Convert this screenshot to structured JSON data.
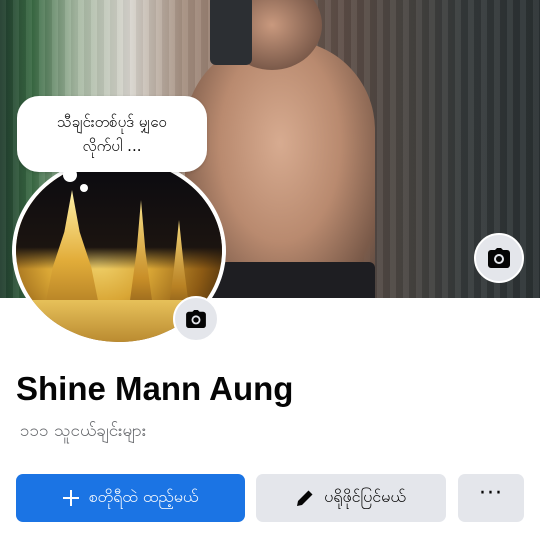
{
  "profile": {
    "name": "Shine Mann Aung",
    "friends": "၁၁၁ သူငယ်ချင်းများ"
  },
  "note_bubble": {
    "line1": "သီချင်းတစ်ပုဒ် မျှဝေ",
    "line2": "လိုက်ပါ ..."
  },
  "actions": {
    "add_story_label": "စတိုရီထဲ ထည့်မယ်",
    "edit_profile_label": "ပရိုဖိုင်ပြင်မယ်",
    "more_label": "···"
  },
  "icons": {
    "cover_camera": "camera-icon",
    "avatar_camera": "camera-icon",
    "add": "plus-icon",
    "edit": "pencil-icon",
    "more": "more-dots-icon"
  },
  "colors": {
    "primary": "#1b74e4",
    "secondary_bg": "#e4e6eb",
    "text": "#050505",
    "muted_text": "#65676b"
  }
}
